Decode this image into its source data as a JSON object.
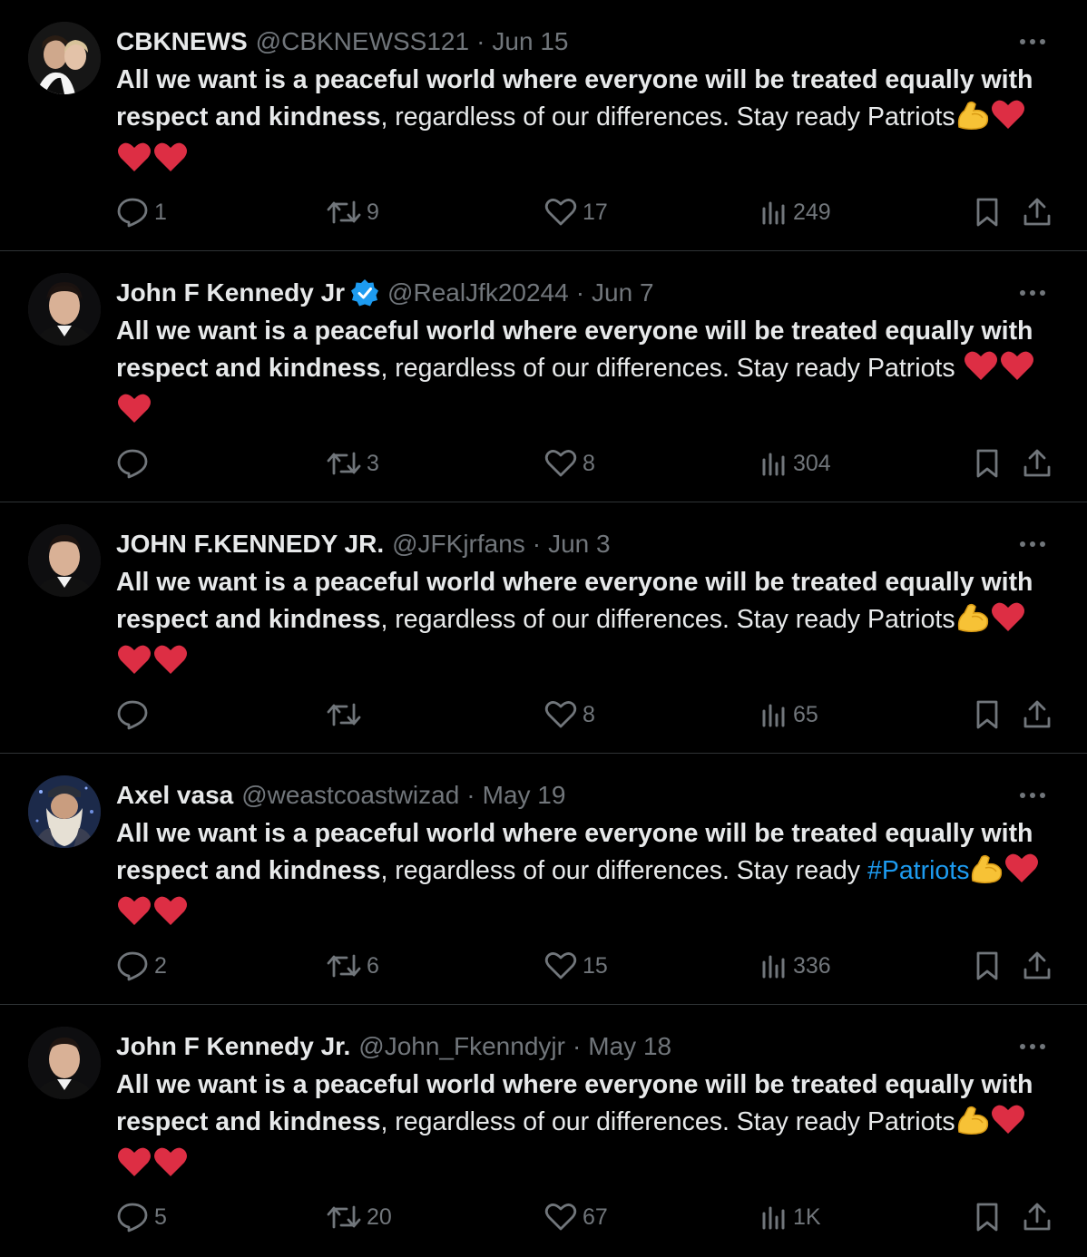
{
  "tweets": [
    {
      "name": "CBKNEWS",
      "verified": false,
      "handle": "@CBKNEWSS121",
      "date": "Jun 15",
      "bold_text": "All we want is a peaceful world where everyone will be treated equally with respect and kindness",
      "rest_text": ", regardless of our differences. Stay ready ",
      "tail_text": "Patriots",
      "tail_is_hashtag": false,
      "emojis": "💪❤️❤️❤️",
      "reply_count": "1",
      "retweet_count": "9",
      "like_count": "17",
      "view_count": "249"
    },
    {
      "name": "John F Kennedy Jr",
      "verified": true,
      "handle": "@RealJfk20244",
      "date": "Jun 7",
      "bold_text": "All we want is a peaceful world where everyone will be treated equally with respect and kindness",
      "rest_text": ", regardless of our differences. Stay ready ",
      "tail_text": "Patriots ",
      "tail_is_hashtag": false,
      "emojis": "❤️❤️❤️",
      "reply_count": "",
      "retweet_count": "3",
      "like_count": "8",
      "view_count": "304"
    },
    {
      "name": "JOHN F.KENNEDY JR.",
      "verified": false,
      "handle": "@JFKjrfans",
      "date": "Jun 3",
      "bold_text": "All we want is a peaceful world where everyone will be treated equally with respect and kindness",
      "rest_text": ", regardless of our differences. Stay ready ",
      "tail_text": "Patriots",
      "tail_is_hashtag": false,
      "emojis": "💪❤️❤️❤️",
      "reply_count": "",
      "retweet_count": "",
      "like_count": "8",
      "view_count": "65"
    },
    {
      "name": "Axel vasa",
      "verified": false,
      "handle": "@weastcoastwizad",
      "date": "May 19",
      "bold_text": "All we want is a peaceful world where everyone will be treated equally with respect and kindness",
      "rest_text": ", regardless of our differences. Stay ready ",
      "tail_text": "#Patriots",
      "tail_is_hashtag": true,
      "emojis": "💪❤️❤️❤️",
      "reply_count": "2",
      "retweet_count": "6",
      "like_count": "15",
      "view_count": "336"
    },
    {
      "name": "John F Kennedy Jr.",
      "verified": false,
      "handle": "@John_Fkenndyjr",
      "date": "May 18",
      "bold_text": "All we want is a peaceful world where everyone will be treated equally with respect and kindness",
      "rest_text": ", regardless of our differences. Stay ready ",
      "tail_text": "Patriots",
      "tail_is_hashtag": false,
      "emojis": "💪❤️❤️❤️",
      "reply_count": "5",
      "retweet_count": "20",
      "like_count": "67",
      "view_count": "1K"
    }
  ],
  "colors": {
    "background": "#000000",
    "text": "#e7e9ea",
    "secondary": "#71767b",
    "accent": "#1d9bf0",
    "divider": "#2f3336"
  },
  "icons": [
    "reply-icon",
    "retweet-icon",
    "like-icon",
    "views-icon",
    "bookmark-icon",
    "share-icon",
    "more-icon",
    "verified-badge-icon",
    "flexed-biceps-emoji",
    "red-heart-emoji"
  ]
}
